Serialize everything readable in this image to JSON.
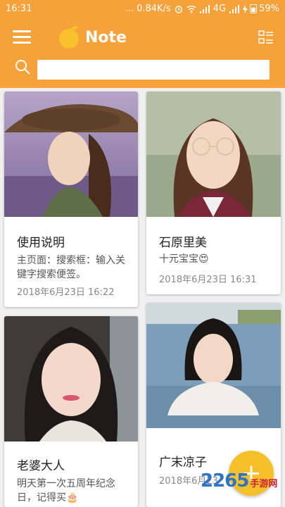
{
  "status_bar": {
    "time": "16:31",
    "net_speed": "... 0.84K/s",
    "network": "4G",
    "battery": "59%",
    "battery_level": 0.59
  },
  "header": {
    "title": "Note",
    "search": {
      "value": "",
      "placeholder": ""
    }
  },
  "notes": [
    {
      "title": "使用说明",
      "body": "主页面：搜索框：输入关键字搜索便签。",
      "date": "2018年6月23日  16:22",
      "photo": "woman-with-hat-in-lavender-field"
    },
    {
      "title": "石原里美",
      "body": "十元宝宝😍",
      "date": "2018年6月23日  16:31",
      "photo": "woman-with-glasses"
    },
    {
      "title": "老婆大人",
      "body": "明天第一次五周年纪念日，记得买🎂",
      "date": "",
      "photo": "smiling-woman-in-car"
    },
    {
      "title": "广末凉子",
      "body": "",
      "date": "2018年6月23",
      "photo": "woman-in-water"
    }
  ],
  "fab": {
    "label": "+"
  },
  "watermark": {
    "main": "2265",
    "sub": "手游网"
  },
  "colors": {
    "accent": "#f7a13a",
    "fab": "#f6c02a",
    "logo": "#f9c12b"
  }
}
